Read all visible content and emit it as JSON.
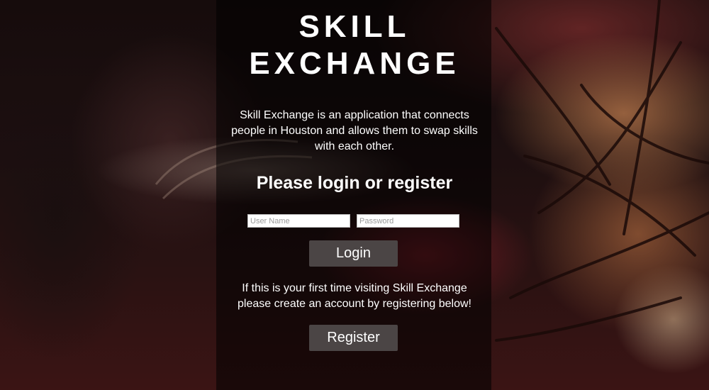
{
  "header": {
    "title_line1": "SKILL",
    "title_line2": "EXCHANGE"
  },
  "intro": {
    "description": "Skill Exchange is an application that connects people in Houston and allows them to swap skills with each other."
  },
  "login": {
    "heading": "Please login or register",
    "username_placeholder": "User Name",
    "password_placeholder": "Password",
    "login_label": "Login"
  },
  "register": {
    "note": "If this is your first time visiting Skill Exchange please create an account by registering below!",
    "register_label": "Register"
  },
  "colors": {
    "overlay": "#000000",
    "button_bg": "#4b4545",
    "text": "#ffffff"
  }
}
